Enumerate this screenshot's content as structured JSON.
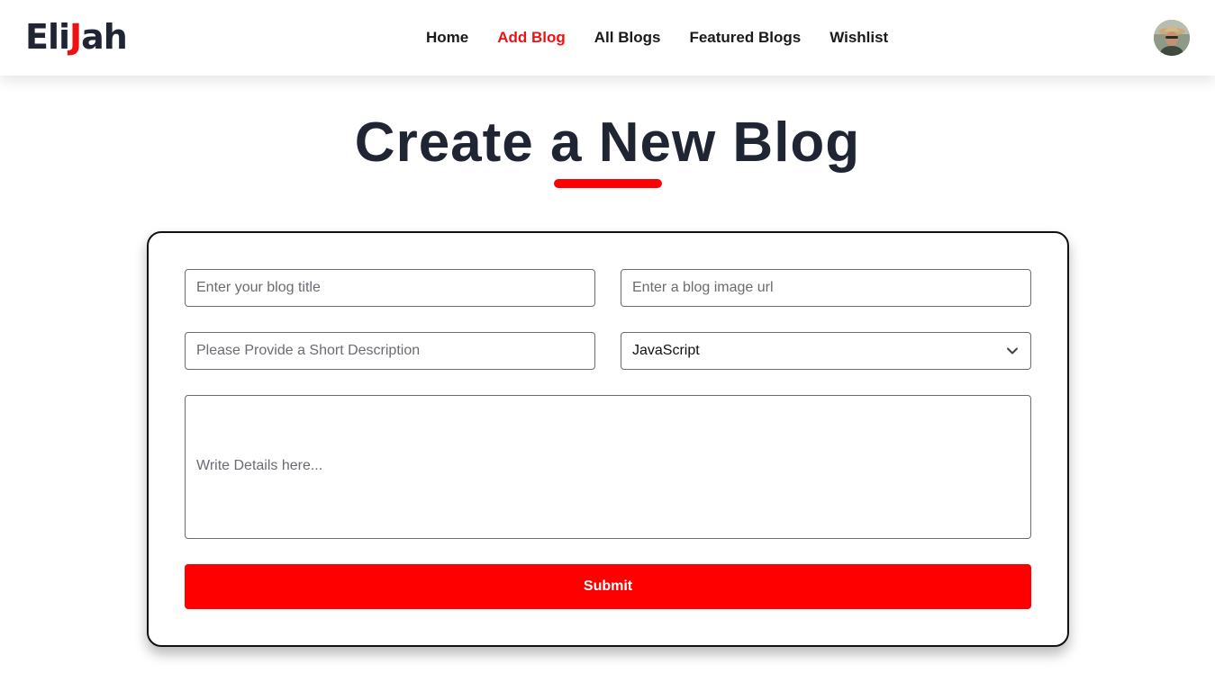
{
  "navbar": {
    "logo": {
      "part_a": "Eli",
      "part_b": "J",
      "part_c": "ah"
    },
    "links": [
      {
        "label": "Home",
        "active": false
      },
      {
        "label": "Add Blog",
        "active": true
      },
      {
        "label": "All Blogs",
        "active": false
      },
      {
        "label": "Featured Blogs",
        "active": false
      },
      {
        "label": "Wishlist",
        "active": false
      }
    ],
    "avatar_icon": "user-avatar-icon"
  },
  "page": {
    "title": "Create a New Blog"
  },
  "form": {
    "title_placeholder": "Enter your blog title",
    "image_placeholder": "Enter a blog image url",
    "description_placeholder": "Please Provide a Short Description",
    "category_selected": "JavaScript",
    "details_placeholder": "Write Details here...",
    "submit_label": "Submit"
  },
  "colors": {
    "accent": "#ff0000",
    "nav_active": "#ee1111",
    "text_dark": "#1f2533",
    "card_border": "#111111"
  },
  "icons": {
    "category_chevron": "chevron-down-icon"
  }
}
